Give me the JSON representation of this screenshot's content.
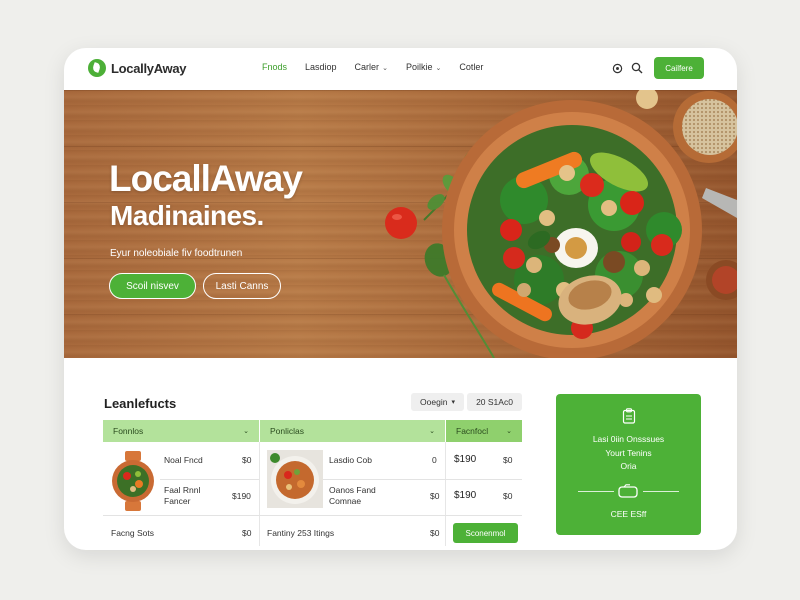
{
  "brand": {
    "name": "LocallyAway"
  },
  "nav": {
    "items": [
      {
        "label": "Fnods",
        "active": true,
        "dropdown": false
      },
      {
        "label": "Lasdiop",
        "active": false,
        "dropdown": false
      },
      {
        "label": "Carler",
        "active": false,
        "dropdown": true
      },
      {
        "label": "Poilkie",
        "active": false,
        "dropdown": true
      },
      {
        "label": "Cotler",
        "active": false,
        "dropdown": false
      }
    ],
    "icons": [
      "cart-icon",
      "search-icon"
    ],
    "cta_label": "Cailfere"
  },
  "hero": {
    "title": "LocallAway",
    "subtitle": "Madinaines.",
    "tagline": "Eyur noleobiale fiv foodtrunen",
    "primary_button": "Scoil nisvev",
    "secondary_button": "Lasti Canns"
  },
  "products": {
    "title": "Leanlefucts",
    "filter_label": "Ooegin",
    "count_label": "20 S1Ac0",
    "columns": [
      {
        "label": "Fonnlos"
      },
      {
        "label": "Ponliclas"
      },
      {
        "label": "Facnfocl"
      }
    ],
    "rows": [
      {
        "name": "Noal Fncd",
        "qty": "$0",
        "name2": "Lasdio Cob",
        "qty2": "0",
        "price": "$190",
        "price2": "$0"
      },
      {
        "name": "Faal Rnnl Fancer",
        "qty": "$190",
        "name2": "Oanos Fand Comnae",
        "qty2": "$0",
        "price": "$190",
        "price2": "$0"
      },
      {
        "name": "Facng Sots",
        "qty": "$0",
        "name2": "Fantiny 253 Itings",
        "qty2": "$0",
        "button": "Sconenmol"
      }
    ]
  },
  "promo": {
    "line1": "Lasi 0iin Onsssues",
    "line2": "Yourt Tenins",
    "line3": "Oria",
    "footer": "CEE ESff"
  },
  "colors": {
    "accent": "#4db137",
    "header_light": "#b3e29b",
    "header_strong": "#8fd06d",
    "wood": "#a8693c"
  }
}
